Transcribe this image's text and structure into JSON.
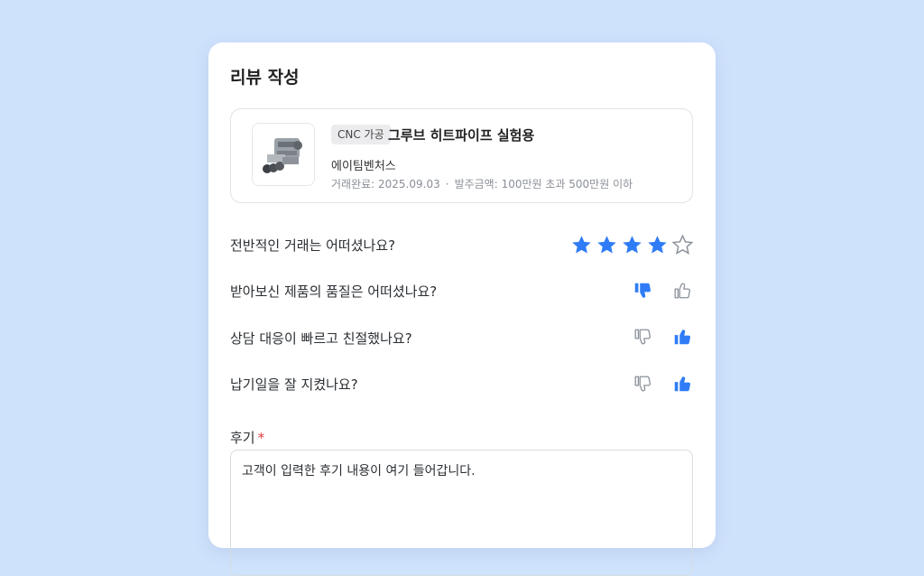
{
  "review": {
    "title": "리뷰 작성",
    "product": {
      "tag": "CNC 가공",
      "name": "그루브 히트파이프 실험용",
      "company": "에이팀벤처스",
      "completed": "거래완료: 2025.09.03",
      "separator": "·",
      "order_amount": "발주금액: 100만원 초과 500만원 이하"
    },
    "questions": [
      {
        "text": "전반적인 거래는 어떠셨나요?",
        "rating": 4,
        "max": 5
      },
      {
        "text": "받아보신 제품의 품질은 어떠셨나요?",
        "selected": "down"
      },
      {
        "text": "상담 대응이 빠르고 친절했나요?",
        "selected": "up"
      },
      {
        "text": "납기일을 잘 지켰나요?",
        "selected": "up"
      }
    ],
    "review_label": "후기",
    "required_mark": "*",
    "review_text": "고객이 입력한 후기 내용이 여기 들어갑니다."
  },
  "colors": {
    "accent": "#2f7cf6",
    "background": "#cfe2fc",
    "inactive": "#8a9099"
  }
}
